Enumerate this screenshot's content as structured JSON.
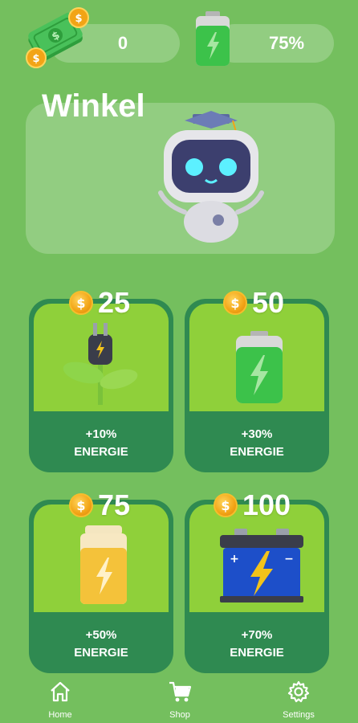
{
  "header": {
    "money_value": "0",
    "energy_value": "75%",
    "money_icon": "money-stack-icon",
    "battery_icon": "battery-icon"
  },
  "shop": {
    "title": "Winkel",
    "mascot_icon": "robot-mascot-icon",
    "items": [
      {
        "price": "25",
        "line1": "+10%",
        "line2": "ENERGIE",
        "icon": "plug-plant-icon"
      },
      {
        "price": "50",
        "line1": "+30%",
        "line2": "ENERGIE",
        "icon": "green-battery-icon"
      },
      {
        "price": "75",
        "line1": "+50%",
        "line2": "ENERGIE",
        "icon": "yellow-battery-icon"
      },
      {
        "price": "100",
        "line1": "+70%",
        "line2": "ENERGIE",
        "icon": "car-battery-icon"
      }
    ]
  },
  "nav": {
    "home": "Home",
    "shop": "Shop",
    "settings": "Settings"
  },
  "colors": {
    "background": "#74bf5e",
    "card_dark": "#2f8a51",
    "card_light": "#8fd03a",
    "coin": "#f2a416"
  }
}
